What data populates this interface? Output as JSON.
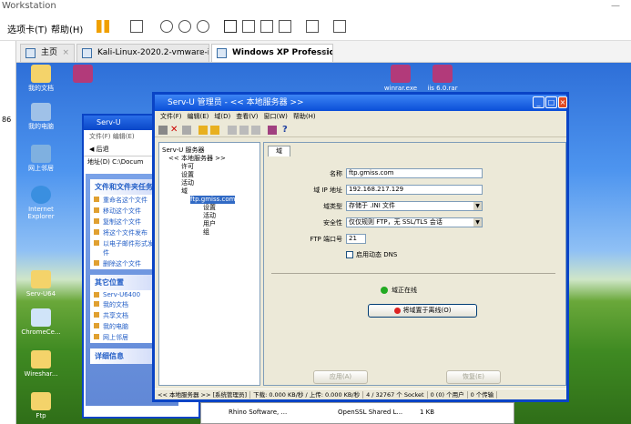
{
  "host": {
    "title": "Workstation",
    "menu": [
      "选项卡(T)",
      "帮助(H)"
    ],
    "tabs": [
      {
        "label": "主页"
      },
      {
        "label": "Kali-Linux-2020.2-vmware-i386"
      },
      {
        "label": "Windows XP Professional"
      }
    ],
    "side_nums": [
      "86"
    ]
  },
  "desktop": {
    "icons": [
      {
        "label": "我的文档"
      },
      {
        "label": "我的电脑"
      },
      {
        "label": "网上邻居"
      },
      {
        "label": "Internet Explorer"
      },
      {
        "label": "Wireshar..."
      },
      {
        "label": "Serv-U64"
      },
      {
        "label": "ChromeCe..."
      },
      {
        "label": "Ftp"
      }
    ],
    "top_labels": [
      "winrar.exe",
      "iis 6.0.rar"
    ]
  },
  "bgwin": {
    "title": "Serv-U",
    "menu": "文件(F)  编辑(E)",
    "back": "后退",
    "addr_label": "地址(D)",
    "addr_value": "C:\\Docum",
    "panels": [
      {
        "title": "文件和文件夹任务",
        "items": [
          "重命名这个文件",
          "移动这个文件",
          "复制这个文件",
          "将这个文件发布",
          "以电子邮件形式发送文件",
          "删除这个文件"
        ]
      },
      {
        "title": "其它位置",
        "items": [
          "Serv-U6400",
          "我的文档",
          "共享文档",
          "我的电脑",
          "网上邻居"
        ]
      },
      {
        "title": "详细信息",
        "items": []
      }
    ]
  },
  "mgr": {
    "title": "Serv-U 管理员 - << 本地服务器 >>",
    "menu": [
      "文件(F)",
      "编辑(E)",
      "域(D)",
      "查看(V)",
      "窗口(W)",
      "帮助(H)"
    ],
    "tree": [
      "Serv-U 服务器",
      "<< 本地服务器 >>",
      "许可",
      "设置",
      "活动",
      "域",
      "ftp.gmiss.com",
      "设置",
      "活动",
      "用户",
      "组"
    ],
    "tab": "域",
    "form": {
      "name_label": "名称",
      "name": "ftp.gmiss.com",
      "ip_label": "域 IP 地址",
      "ip": "192.168.217.129",
      "type_label": "域类型",
      "type": "存储于 .INI 文件",
      "sec_label": "安全性",
      "sec": "仅仅规则 FTP，无 SSL/TLS 会话",
      "port_label": "FTP 端口号",
      "port": "21",
      "dns": "启用动态 DNS"
    },
    "online": "域正在线",
    "offline_btn": "将域置于离线(O)",
    "apply": "应用(A)",
    "revert": "恢复(E)",
    "status": [
      "<< 本地服务器 >>  [系统管理员]",
      "下载: 0.000 KB/秒 / 上传: 0.000 KB/秒",
      "4 / 32767 个 Socket",
      "0 (0) 个用户",
      "0 个传输"
    ]
  },
  "taskbar": [
    "Rhino Software, ...",
    "OpenSSL Shared L...",
    "1 KB"
  ]
}
